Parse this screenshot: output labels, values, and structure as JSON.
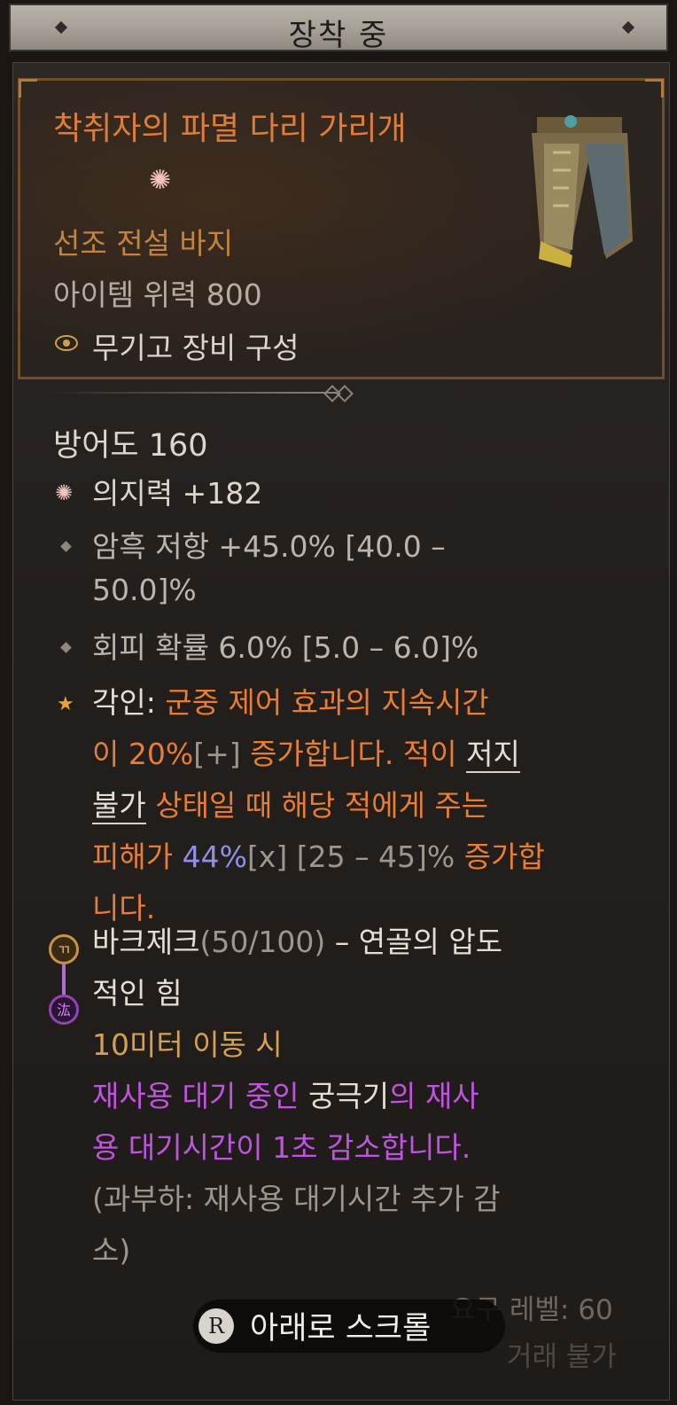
{
  "header": {
    "title": "장착 중"
  },
  "item": {
    "name": "착취자의 파멸 다리 가리개",
    "type": "선조 전설 바지",
    "power": "아이템 위력 800",
    "armory": "무기고 장비 구성"
  },
  "stats": {
    "armor": "방어도 160",
    "willpower": "의지력 +182",
    "shadow_res_a": "암흑 저항 +45.0% [40.0 –",
    "shadow_res_b": "50.0]%",
    "dodge": "회피 확률 6.0% [5.0 – 6.0]%"
  },
  "aspect": {
    "label": "각인: ",
    "p1": "군중 제어 효과의 지속시간",
    "p2": "이 20%",
    "p2b": "[+]",
    "p2c": " 증가합니다. 적이 ",
    "unstoppable_a": "저지",
    "unstoppable_b": "불가",
    "p3": " 상태일 때 해당 적에게 주는",
    "p4": "피해가 ",
    "pct": "44%",
    "x": "[x]",
    "range": " [25 – 45]% ",
    "p5": "증가합",
    "p6": "니다."
  },
  "paragon": {
    "name_a": "바크제크",
    "count": "(50/100)",
    "name_b": " – 연골의 압도",
    "name_c": "적인 힘",
    "trigger": "10미터 이동 시",
    "e1": "재사용 대기 중인 ",
    "e2": "궁극기",
    "e3": "의 재사",
    "e4": "용 대기시간이 1초 감소합니다.",
    "overload_a": "(과부하: 재사용 대기시간 추가 감",
    "overload_b": "소)",
    "glyph1": "ㄲ",
    "glyph2": "汯"
  },
  "footer": {
    "level": "요구 레벨: 60",
    "trade": "거래 불가"
  },
  "scroll": {
    "button": "R",
    "label": "아래로 스크롤"
  }
}
